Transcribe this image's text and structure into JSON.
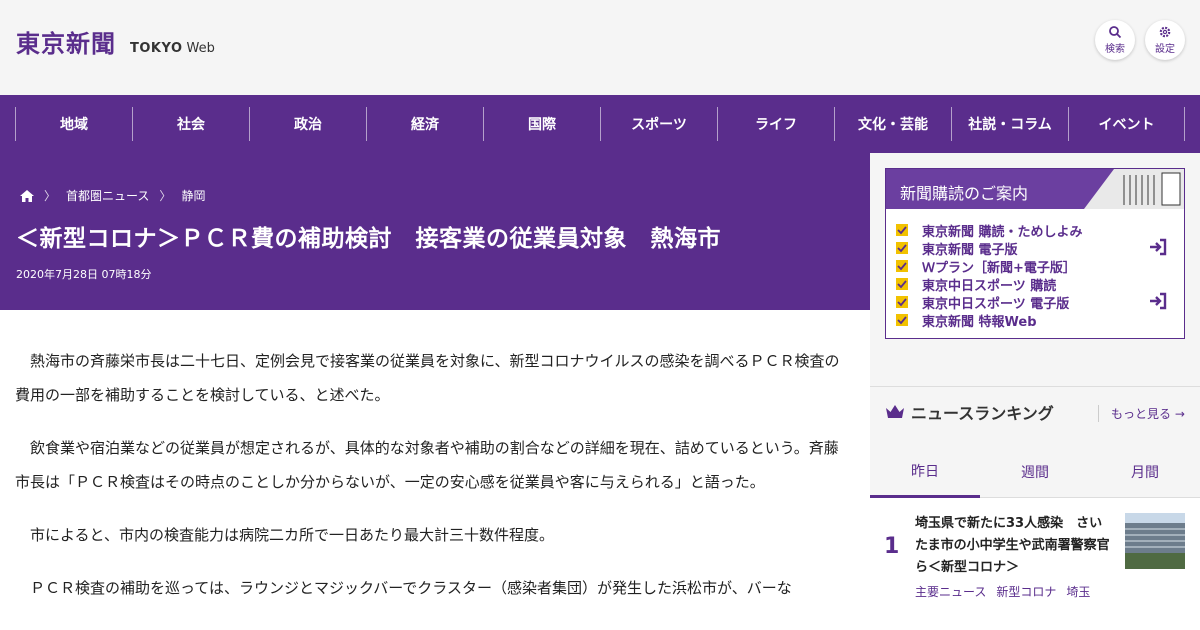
{
  "header": {
    "logo_jp": "東京新聞",
    "logo_en": "TOKYO",
    "logo_web": "Web",
    "search_label": "検索",
    "settings_label": "設定"
  },
  "nav": {
    "items": [
      {
        "label": "地域"
      },
      {
        "label": "社会"
      },
      {
        "label": "政治"
      },
      {
        "label": "経済"
      },
      {
        "label": "国際"
      },
      {
        "label": "スポーツ"
      },
      {
        "label": "ライフ"
      },
      {
        "label": "文化・芸能"
      },
      {
        "label": "社説・コラム"
      },
      {
        "label": "イベント"
      }
    ]
  },
  "breadcrumb": {
    "items": [
      "首都圏ニュース",
      "静岡"
    ]
  },
  "article": {
    "title": "＜新型コロナ＞ＰＣＲ費の補助検討　接客業の従業員対象　熱海市",
    "date": "2020年7月28日 07時18分",
    "paragraphs": [
      "熱海市の斉藤栄市長は二十七日、定例会見で接客業の従業員を対象に、新型コロナウイルスの感染を調べるＰＣＲ検査の費用の一部を補助することを検討している、と述べた。",
      "飲食業や宿泊業などの従業員が想定されるが、具体的な対象者や補助の割合などの詳細を現在、詰めているという。斉藤市長は「ＰＣＲ検査はその時点のことしか分からないが、一定の安心感を従業員や客に与えられる」と語った。",
      "市によると、市内の検査能力は病院二カ所で一日あたり最大計三十数件程度。",
      "ＰＣＲ検査の補助を巡っては、ラウンジとマジックバーでクラスター（感染者集団）が発生した浜松市が、バーな"
    ]
  },
  "subscription": {
    "heading": "新聞購読のご案内",
    "items": [
      {
        "label": "東京新聞 購読・ためしよみ"
      },
      {
        "label": "東京新聞 電子版"
      },
      {
        "label": "Ｗプラン［新聞+電子版］"
      },
      {
        "label": "東京中日スポーツ 購読"
      },
      {
        "label": "東京中日スポーツ 電子版"
      },
      {
        "label": "東京新聞 特報Web"
      }
    ]
  },
  "ranking": {
    "heading": "ニュースランキング",
    "more": "もっと見る",
    "tabs": [
      {
        "label": "昨日"
      },
      {
        "label": "週間"
      },
      {
        "label": "月間"
      }
    ],
    "items": [
      {
        "rank": "1",
        "title": "埼玉県で新たに33人感染　さいたま市の小中学生や武南署警察官ら＜新型コロナ＞",
        "tags": [
          "主要ニュース",
          "新型コロナ",
          "埼玉"
        ]
      }
    ]
  },
  "colors": {
    "brand": "#5a2d8c",
    "accent_check": "#f2c200"
  }
}
